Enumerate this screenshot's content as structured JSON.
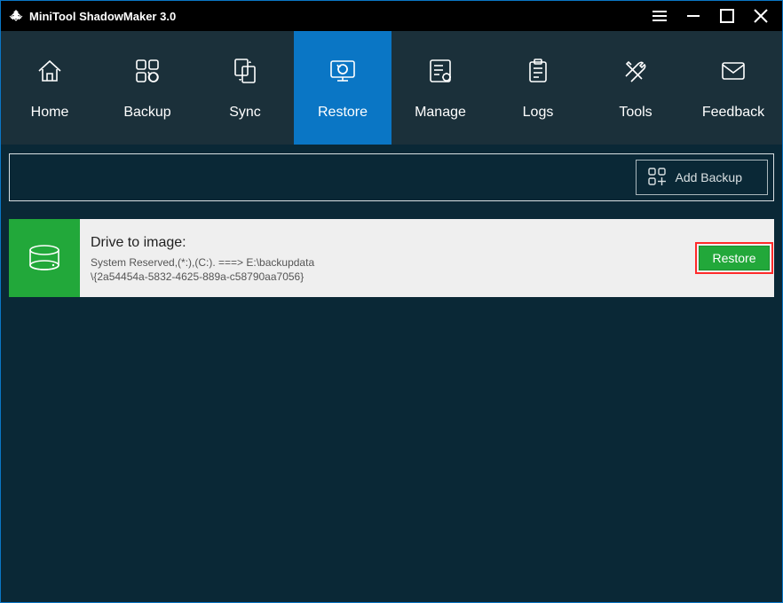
{
  "window": {
    "title": "MiniTool ShadowMaker 3.0"
  },
  "nav": {
    "items": [
      {
        "label": "Home"
      },
      {
        "label": "Backup"
      },
      {
        "label": "Sync"
      },
      {
        "label": "Restore"
      },
      {
        "label": "Manage"
      },
      {
        "label": "Logs"
      },
      {
        "label": "Tools"
      },
      {
        "label": "Feedback"
      }
    ],
    "active_index": 3
  },
  "toolbar": {
    "add_backup_label": "Add Backup"
  },
  "entry": {
    "title": "Drive to image:",
    "detail": "System Reserved,(*:),(C:). ===> E:\\backupdata\n\\{2a54454a-5832-4625-889a-c58790aa7056}",
    "restore_label": "Restore"
  }
}
